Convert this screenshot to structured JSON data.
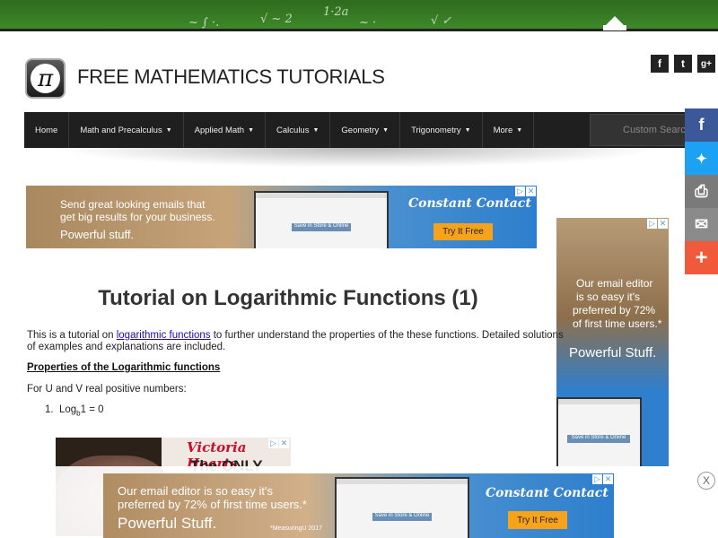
{
  "chalkboard": {
    "formula": "1·2a"
  },
  "site": {
    "logo_symbol": "π",
    "title": "FREE MATHEMATICS TUTORIALS"
  },
  "social_top": [
    "f",
    "t",
    "g+"
  ],
  "nav": {
    "items": [
      "Home",
      "Math and Precalculus",
      "Applied Math",
      "Calculus",
      "Geometry",
      "Trigonometry",
      "More"
    ],
    "search_placeholder": "Custom Search"
  },
  "share_bar": [
    {
      "icon": "facebook-icon",
      "glyph": "f",
      "color": "#3b5998"
    },
    {
      "icon": "twitter-icon",
      "glyph": "✦",
      "color": "#1da1f2"
    },
    {
      "icon": "print-icon",
      "glyph": "⎙",
      "color": "#7a7a7a"
    },
    {
      "icon": "email-icon",
      "glyph": "✉",
      "color": "#8a8a8a"
    },
    {
      "icon": "plus-icon",
      "glyph": "+",
      "color": "#f05a3a"
    }
  ],
  "ad_top": {
    "line1": "Send great looking emails that",
    "line2": "get big results for your business.",
    "line3": "Powerful stuff.",
    "brand": "Constant Contact",
    "button": "Try It Free",
    "mock_title": "Save in Store & Online"
  },
  "ad_side": {
    "line1": "Our email editor",
    "line2": "is so easy it's",
    "line3": "preferred by 72%",
    "line4": "of first time users.*",
    "tagline": "Powerful Stuff.",
    "mock_title": "Save in Store & Online"
  },
  "main": {
    "title": "Tutorial on Logarithmic Functions (1)",
    "intro_before": "This is a tutorial on ",
    "intro_link": "logarithmic functions",
    "intro_after": " to further understand the properties of the these functions. Detailed solutions",
    "intro_line2": "of examples and explanations are included.",
    "properties_heading": "Properties of the Logarithmic functions",
    "condition": "For U and V real positive numbers:",
    "item1_num": "1.",
    "item1_log": "Log",
    "item1_sub": "b",
    "item1_rest": "1 = 0"
  },
  "ad_vh": {
    "brand": "Victoria Hearts",
    "text": "The ONLY"
  },
  "ad_bottom": {
    "line1": "Our email editor is so easy it's",
    "line2": "preferred by 72% of first time users.*",
    "tagline": "Powerful Stuff.",
    "footnote": "*MeasuringU 2017",
    "brand": "Constant Contact",
    "button": "Try It Free",
    "mock_title": "Save in Store & Online"
  },
  "close_label": "X"
}
